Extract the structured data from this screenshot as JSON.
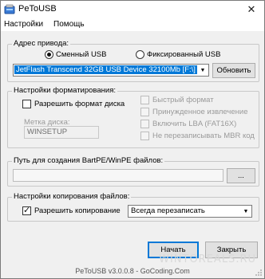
{
  "window": {
    "title": "PeToUSB"
  },
  "menu": [
    "Настройки",
    "Помощь"
  ],
  "drive": {
    "group_label": "Адрес привода:",
    "radio_removable": "Сменный USB",
    "radio_fixed": "Фиксированный USB",
    "selected_radio": "removable",
    "device_value": "JetFlash Transcend 32GB USB Device 32100Mb [F:\\]",
    "refresh_label": "Обновить"
  },
  "format": {
    "group_label": "Настройки форматирования:",
    "enable_format_label": "Разрешить формат диска",
    "enable_format_checked": false,
    "volume_label_caption": "Метка диска:",
    "volume_label_value": "WINSETUP",
    "quick_format_label": "Быстрый формат",
    "force_unmount_label": "Принужденное извлечение",
    "lba_label": "Включить LBA (FAT16X)",
    "no_mbr_label": "Не перезаписывать MBR код"
  },
  "path": {
    "group_label": "Путь для создания BartPE/WinPE файлов:",
    "value": "",
    "browse_label": "..."
  },
  "copy": {
    "group_label": "Настройки копирования файлов:",
    "enable_copy_label": "Разрешить копирование",
    "enable_copy_checked": true,
    "mode_value": "Всегда перезаписать"
  },
  "buttons": {
    "start": "Начать",
    "close": "Закрыть"
  },
  "status": {
    "text": "PeToUSB v3.0.0.8 - GoCoding.Com",
    "watermark": "WINTOREALS.RU"
  },
  "colors": {
    "accent": "#0078d7"
  }
}
